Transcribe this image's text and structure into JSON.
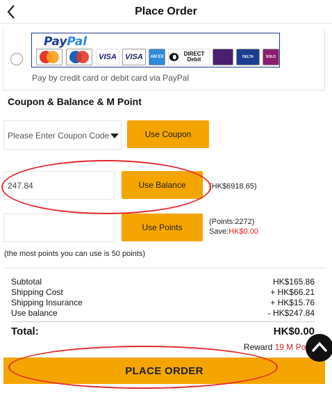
{
  "header": {
    "title": "Place Order",
    "back_icon": "chevron-left-icon"
  },
  "paypal": {
    "logo_pay": "Pay",
    "logo_pal": "Pal",
    "caption": "Pay by credit card or debit card via PayPal",
    "cards": [
      "MasterCard",
      "Maestro",
      "VISA",
      "VISA ELECTRON",
      "AMERICAN EXPRESS",
      "DIRECT Debit",
      "LASER",
      "DELTA",
      "SOLO"
    ]
  },
  "section": {
    "title": "Coupon & Balance & M Point"
  },
  "coupon": {
    "placeholder": "Please Enter Coupon Code",
    "button": "Use Coupon"
  },
  "balance": {
    "value": "247.84",
    "button": "Use Balance",
    "available": "(HK$6918.65)"
  },
  "points": {
    "button": "Use Points",
    "available": "(Points:2272)",
    "save_label": "Save:",
    "save_value": "HK$0.00",
    "note": "(the most points you can use is 50 points)"
  },
  "summary": {
    "rows": [
      {
        "label": "Subtotal",
        "value": "HK$165.86"
      },
      {
        "label": "Shipping Cost",
        "value": "+ HK$66.21"
      },
      {
        "label": "Shipping Insurance",
        "value": "+ HK$15.76"
      },
      {
        "label": "Use balance",
        "value": "- HK$247.84"
      }
    ],
    "total_label": "Total:",
    "total_value": "HK$0.00",
    "reward_label": "Reward",
    "reward_value": "19 M Point"
  },
  "place_order": {
    "label": "PLACE ORDER"
  },
  "colors": {
    "accent": "#f5a500",
    "highlight": "#e02020",
    "annotation": "#e2282e"
  }
}
